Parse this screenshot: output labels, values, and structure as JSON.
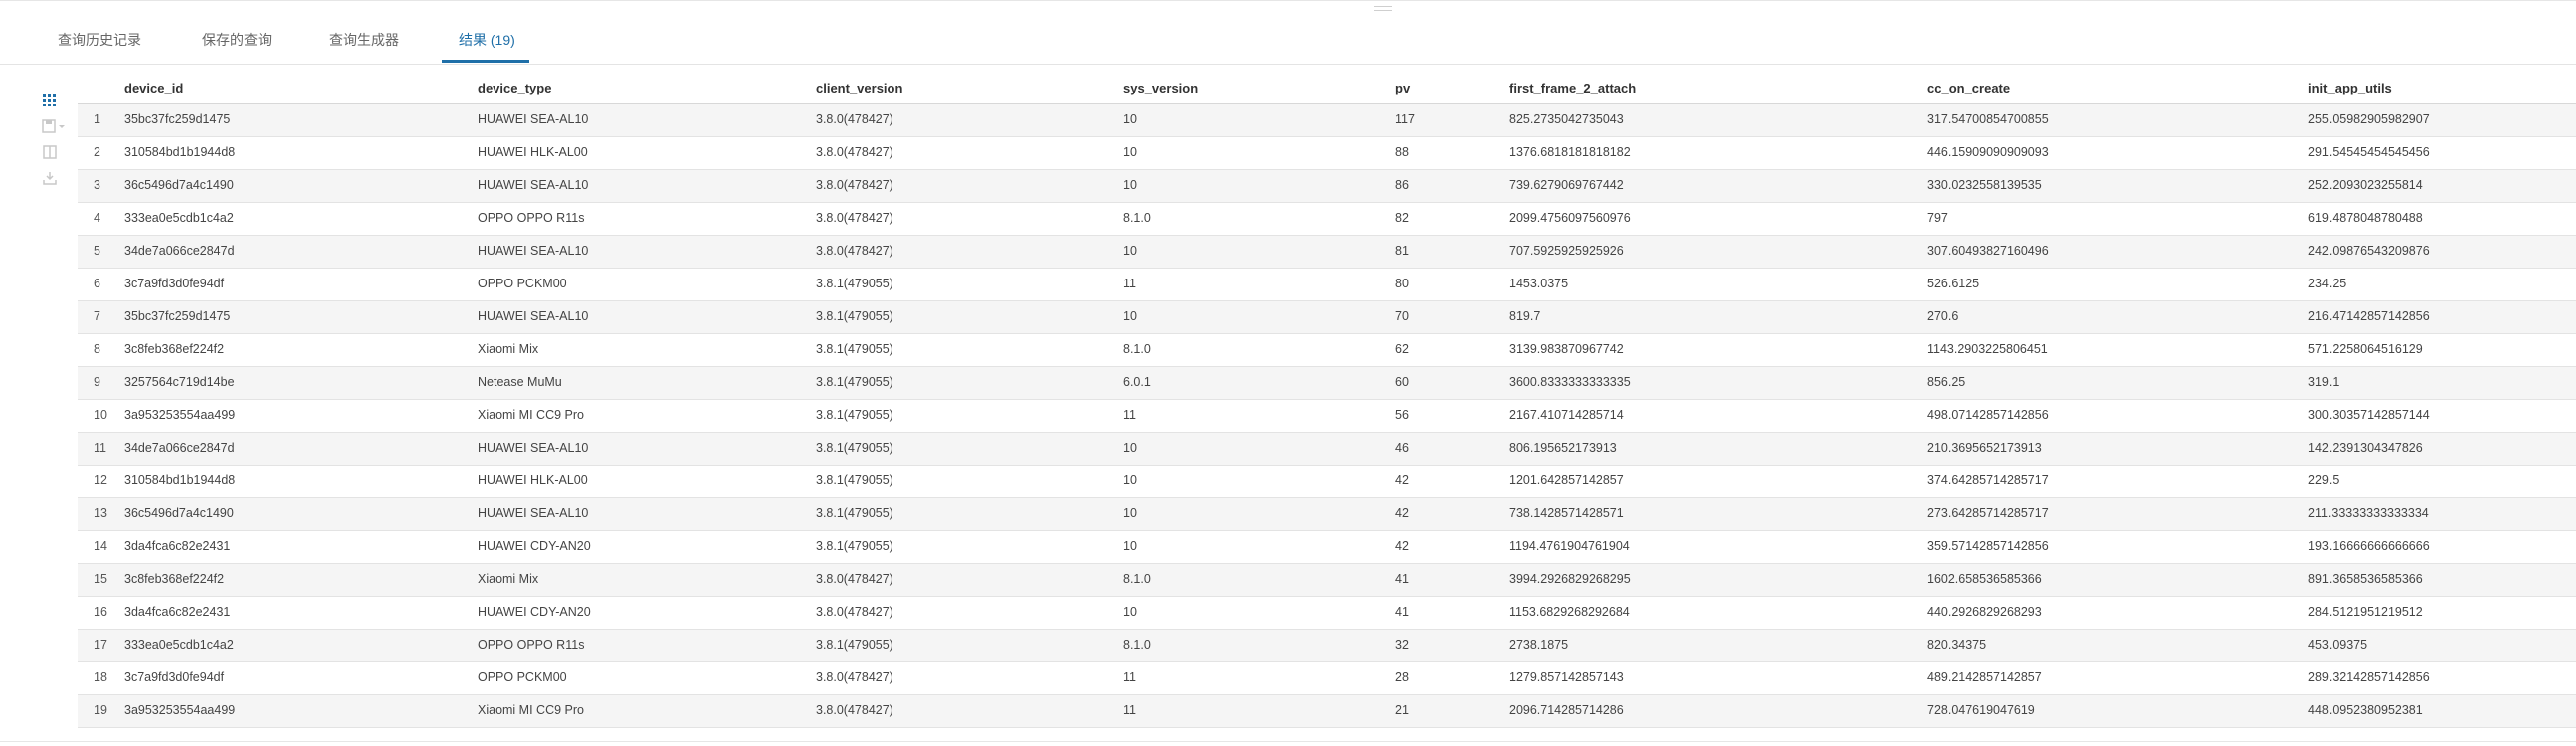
{
  "tabs": [
    {
      "label": "查询历史记录",
      "active": false
    },
    {
      "label": "保存的查询",
      "active": false
    },
    {
      "label": "查询生成器",
      "active": false
    },
    {
      "label": "结果 (19)",
      "active": true
    }
  ],
  "sidebar": [
    "grid-view-icon",
    "save-dropdown-icon",
    "split-view-icon",
    "download-icon"
  ],
  "colors": {
    "accent": "#1f6fa8",
    "row_stripe": "#f5f5f5"
  },
  "table": {
    "columns": [
      "device_id",
      "device_type",
      "client_version",
      "sys_version",
      "pv",
      "first_frame_2_attach",
      "cc_on_create",
      "init_app_utils"
    ],
    "rows": [
      {
        "n": "1",
        "cells": [
          "35bc37fc259d1475",
          "HUAWEI SEA-AL10",
          "3.8.0(478427)",
          "10",
          "117",
          "825.2735042735043",
          "317.54700854700855",
          "255.05982905982907"
        ]
      },
      {
        "n": "2",
        "cells": [
          "310584bd1b1944d8",
          "HUAWEI HLK-AL00",
          "3.8.0(478427)",
          "10",
          "88",
          "1376.6818181818182",
          "446.15909090909093",
          "291.54545454545456"
        ]
      },
      {
        "n": "3",
        "cells": [
          "36c5496d7a4c1490",
          "HUAWEI SEA-AL10",
          "3.8.0(478427)",
          "10",
          "86",
          "739.6279069767442",
          "330.0232558139535",
          "252.2093023255814"
        ]
      },
      {
        "n": "4",
        "cells": [
          "333ea0e5cdb1c4a2",
          "OPPO OPPO R11s",
          "3.8.0(478427)",
          "8.1.0",
          "82",
          "2099.4756097560976",
          "797",
          "619.4878048780488"
        ]
      },
      {
        "n": "5",
        "cells": [
          "34de7a066ce2847d",
          "HUAWEI SEA-AL10",
          "3.8.0(478427)",
          "10",
          "81",
          "707.5925925925926",
          "307.60493827160496",
          "242.09876543209876"
        ]
      },
      {
        "n": "6",
        "cells": [
          "3c7a9fd3d0fe94df",
          "OPPO PCKM00",
          "3.8.1(479055)",
          "11",
          "80",
          "1453.0375",
          "526.6125",
          "234.25"
        ]
      },
      {
        "n": "7",
        "cells": [
          "35bc37fc259d1475",
          "HUAWEI SEA-AL10",
          "3.8.1(479055)",
          "10",
          "70",
          "819.7",
          "270.6",
          "216.47142857142856"
        ]
      },
      {
        "n": "8",
        "cells": [
          "3c8feb368ef224f2",
          "Xiaomi Mix",
          "3.8.1(479055)",
          "8.1.0",
          "62",
          "3139.983870967742",
          "1143.2903225806451",
          "571.2258064516129"
        ]
      },
      {
        "n": "9",
        "cells": [
          "3257564c719d14be",
          "Netease MuMu",
          "3.8.1(479055)",
          "6.0.1",
          "60",
          "3600.8333333333335",
          "856.25",
          "319.1"
        ]
      },
      {
        "n": "10",
        "cells": [
          "3a953253554aa499",
          "Xiaomi MI CC9 Pro",
          "3.8.1(479055)",
          "11",
          "56",
          "2167.410714285714",
          "498.07142857142856",
          "300.30357142857144"
        ]
      },
      {
        "n": "11",
        "cells": [
          "34de7a066ce2847d",
          "HUAWEI SEA-AL10",
          "3.8.1(479055)",
          "10",
          "46",
          "806.195652173913",
          "210.3695652173913",
          "142.2391304347826"
        ]
      },
      {
        "n": "12",
        "cells": [
          "310584bd1b1944d8",
          "HUAWEI HLK-AL00",
          "3.8.1(479055)",
          "10",
          "42",
          "1201.642857142857",
          "374.64285714285717",
          "229.5"
        ]
      },
      {
        "n": "13",
        "cells": [
          "36c5496d7a4c1490",
          "HUAWEI SEA-AL10",
          "3.8.1(479055)",
          "10",
          "42",
          "738.1428571428571",
          "273.64285714285717",
          "211.33333333333334"
        ]
      },
      {
        "n": "14",
        "cells": [
          "3da4fca6c82e2431",
          "HUAWEI CDY-AN20",
          "3.8.1(479055)",
          "10",
          "42",
          "1194.4761904761904",
          "359.57142857142856",
          "193.16666666666666"
        ]
      },
      {
        "n": "15",
        "cells": [
          "3c8feb368ef224f2",
          "Xiaomi Mix",
          "3.8.0(478427)",
          "8.1.0",
          "41",
          "3994.2926829268295",
          "1602.658536585366",
          "891.3658536585366"
        ]
      },
      {
        "n": "16",
        "cells": [
          "3da4fca6c82e2431",
          "HUAWEI CDY-AN20",
          "3.8.0(478427)",
          "10",
          "41",
          "1153.6829268292684",
          "440.2926829268293",
          "284.5121951219512"
        ]
      },
      {
        "n": "17",
        "cells": [
          "333ea0e5cdb1c4a2",
          "OPPO OPPO R11s",
          "3.8.1(479055)",
          "8.1.0",
          "32",
          "2738.1875",
          "820.34375",
          "453.09375"
        ]
      },
      {
        "n": "18",
        "cells": [
          "3c7a9fd3d0fe94df",
          "OPPO PCKM00",
          "3.8.0(478427)",
          "11",
          "28",
          "1279.857142857143",
          "489.2142857142857",
          "289.32142857142856"
        ]
      },
      {
        "n": "19",
        "cells": [
          "3a953253554aa499",
          "Xiaomi MI CC9 Pro",
          "3.8.0(478427)",
          "11",
          "21",
          "2096.714285714286",
          "728.047619047619",
          "448.0952380952381"
        ]
      }
    ]
  }
}
